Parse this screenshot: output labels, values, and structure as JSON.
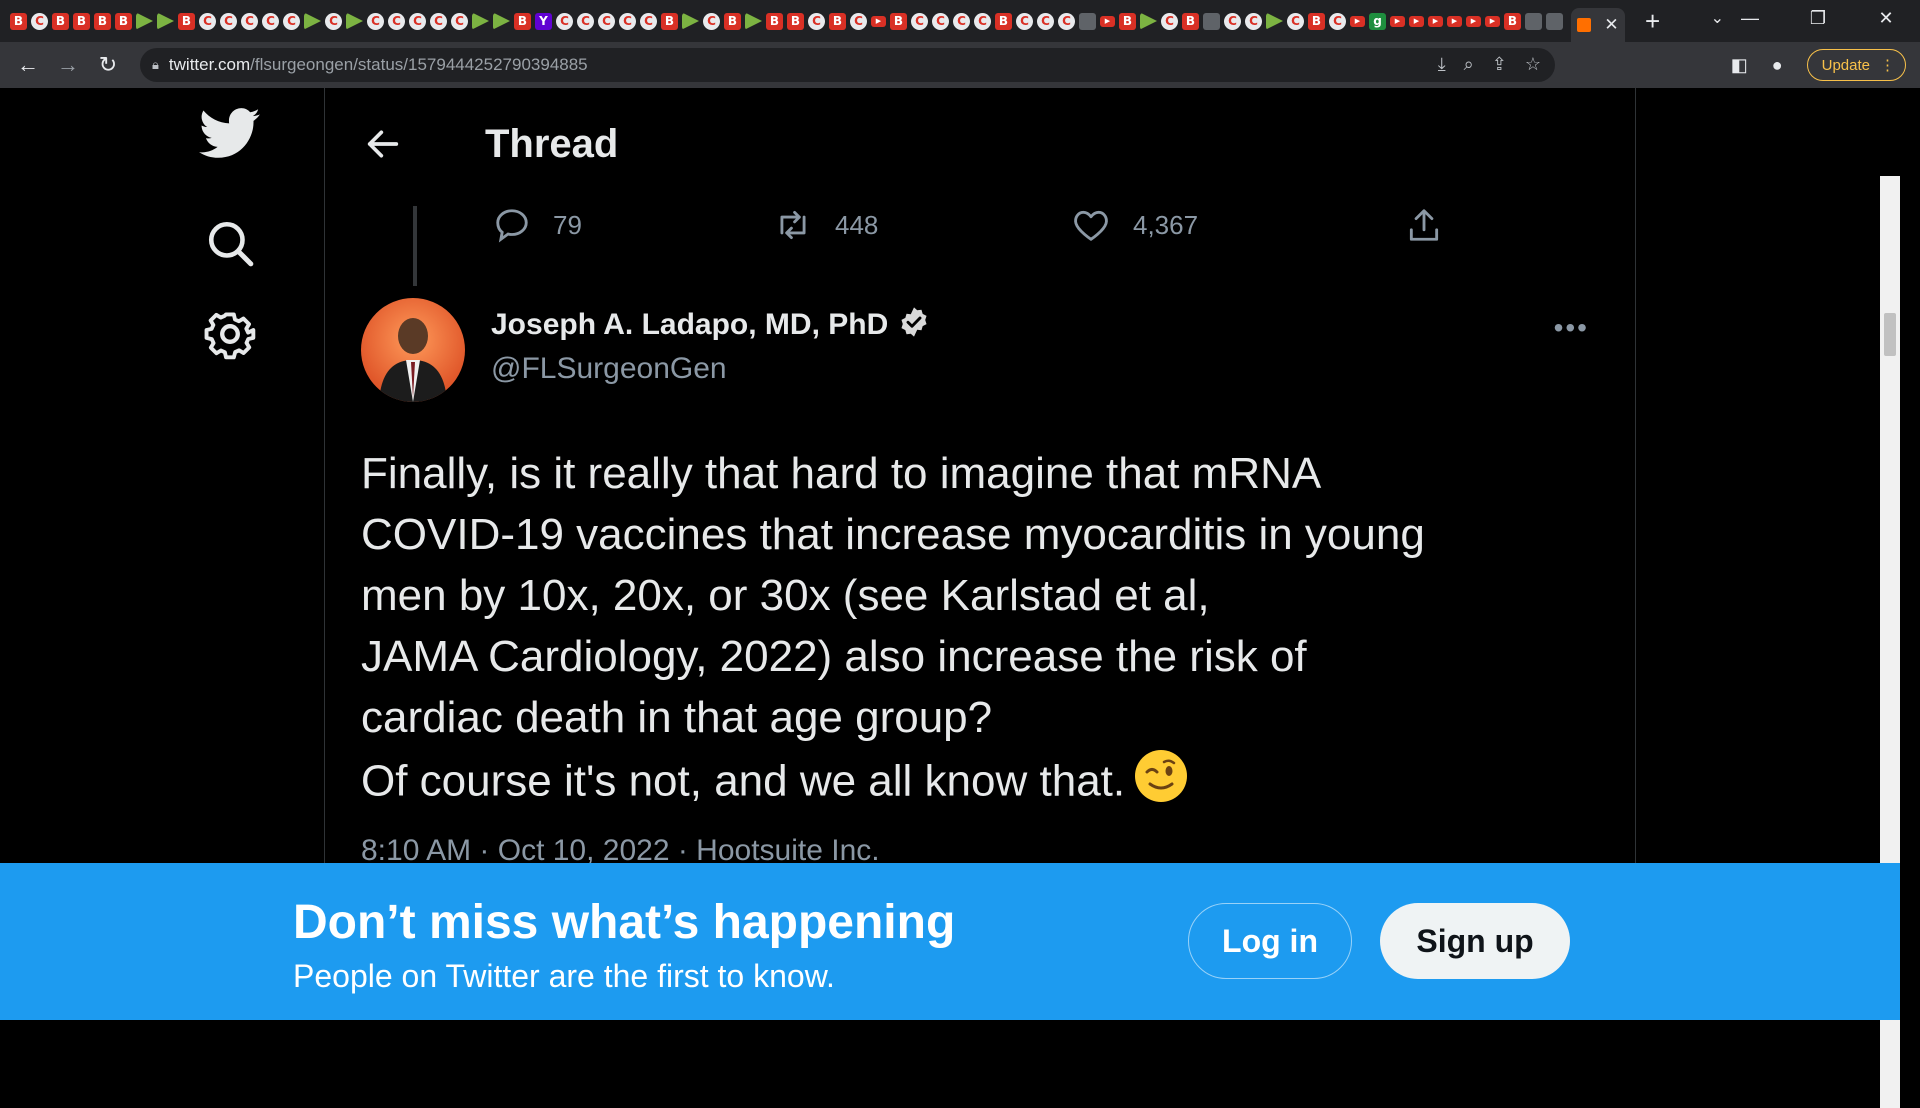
{
  "browser": {
    "url_domain": "twitter.com",
    "url_path": "/flsurgeongen/status/1579444252790394885",
    "update_label": "Update",
    "tab_favicons": [
      "B",
      "C",
      "B",
      "B",
      "B",
      "B",
      "D",
      "D",
      "B",
      "C",
      "C",
      "C",
      "C",
      "C",
      "D",
      "C",
      "D",
      "C",
      "C",
      "C",
      "C",
      "C",
      "D",
      "D",
      "B",
      "y",
      "C",
      "C",
      "C",
      "C",
      "C",
      "B",
      "D",
      "C",
      "B",
      "D",
      "B",
      "B",
      "C",
      "B",
      "C",
      "r",
      "B",
      "C",
      "C",
      "C",
      "C",
      "B",
      "C",
      "C",
      "C",
      "s",
      "r",
      "B",
      "D",
      "C",
      "B",
      "s",
      "C",
      "C",
      "D",
      "C",
      "B",
      "C",
      "r",
      "g",
      "r",
      "r",
      "r",
      "r",
      "r",
      "r",
      "B",
      "s",
      "s"
    ]
  },
  "nav": {
    "logo": "twitter-bird-icon",
    "items": [
      "search-icon",
      "settings-icon"
    ]
  },
  "header": {
    "title": "Thread"
  },
  "previous_tweet": {
    "replies": "79",
    "retweets": "448",
    "likes": "4,367"
  },
  "tweet": {
    "author_name": "Joseph A. Ladapo, MD, PhD",
    "handle": "@FLSurgeonGen",
    "text": "Finally, is it really that hard to imagine that mRNA\nCOVID-19 vaccines that increase myocarditis in young\nmen by 10x, 20x, or 30x (see Karlstad et al,\nJAMA Cardiology, 2022) also increase the risk of\ncardiac death in that age group?\nOf course it's not, and we all know that.",
    "emoji": "winking-face",
    "timestamp": "8:10 AM · Oct 10, 2022 · Hootsuite Inc."
  },
  "banner": {
    "title": "Don’t miss what’s happening",
    "subtitle": "People on Twitter are the first to know.",
    "login_label": "Log in",
    "signup_label": "Sign up"
  },
  "colors": {
    "twitter_blue": "#1d9bf0",
    "background": "#000000",
    "text_primary": "#e7e9ea",
    "text_secondary": "#8b98a5"
  }
}
